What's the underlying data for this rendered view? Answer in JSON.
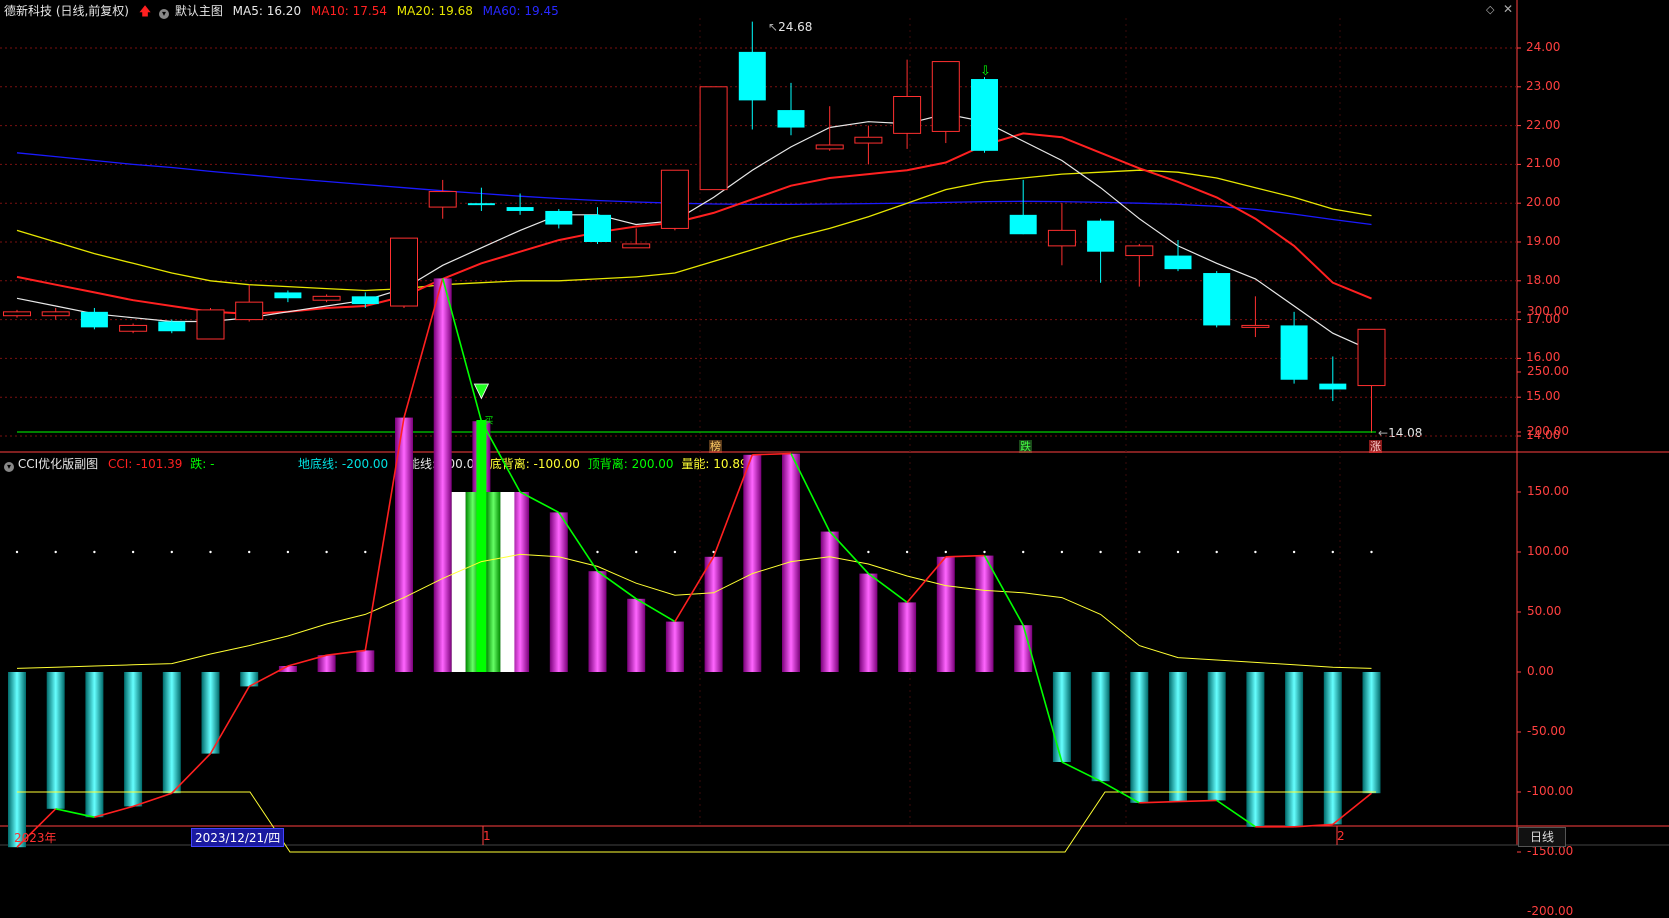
{
  "colors": {
    "bg": "#000000",
    "up": "#ff3030",
    "down": "#00ffff",
    "ma5": "#e8e8e8",
    "ma10": "#ff2020",
    "ma20": "#e6e600",
    "ma60": "#1a1aff",
    "axis": "#ff4040",
    "grid": "#7a1010",
    "bar_pos": "#cc00cc",
    "bar_neg": "#00c8c8",
    "green": "#00ff00",
    "yellow": "#ffff33",
    "cyan": "#00ffff"
  },
  "main": {
    "title": "德新科技 (日线,前复权)",
    "arrow_icon": "red-up-arrow-icon",
    "collapse_icon": "collapse-icon",
    "template_name": "默认主图",
    "ma5": "MA5: 16.20",
    "ma10": "MA10: 17.54",
    "ma20": "MA20: 19.68",
    "ma60": "MA60: 19.45",
    "high_label": "24.68",
    "low_label": "14.08",
    "markers": [
      "榜",
      "跌",
      "涨"
    ],
    "y_ticks": [
      "24.00",
      "23.00",
      "22.00",
      "21.00",
      "20.00",
      "19.00",
      "18.00",
      "17.00",
      "16.00",
      "15.00",
      "14.00"
    ]
  },
  "sub": {
    "title": "CCI优化版副图",
    "cci": "CCI: -101.39",
    "die": "跌: -",
    "dideng": "地底线: -200.00",
    "niuneng": "牛能线: 100.00",
    "dibeili": "底背离: -100.00",
    "dingbeili": "顶背离: 200.00",
    "liangneng": "量能: 10.89",
    "y_ticks": [
      "300.00",
      "250.00",
      "200.00",
      "150.00",
      "100.00",
      "50.00",
      "0.00",
      "-50.00",
      "-100.00",
      "-150.00",
      "-200.00"
    ],
    "signal_label": "买"
  },
  "bottom": {
    "year_label": "2023年",
    "cursor_date": "2023/12/21/四",
    "month1": "1",
    "month2": "2",
    "period_button": "日线"
  },
  "chart_data": [
    {
      "type": "candlestick",
      "title": "德新科技 (日线,前复权)",
      "ylim": [
        14.0,
        24.0
      ],
      "candles": [
        {
          "open": 17.1,
          "close": 17.2,
          "high": 17.25,
          "low": 17.05
        },
        {
          "open": 17.1,
          "close": 17.2,
          "high": 17.3,
          "low": 17.0
        },
        {
          "open": 17.2,
          "close": 16.8,
          "high": 17.3,
          "low": 16.75
        },
        {
          "open": 16.7,
          "close": 16.85,
          "high": 16.9,
          "low": 16.65
        },
        {
          "open": 16.95,
          "close": 16.7,
          "high": 17.0,
          "low": 16.65
        },
        {
          "open": 16.5,
          "close": 17.25,
          "high": 17.3,
          "low": 16.5
        },
        {
          "open": 17.0,
          "close": 17.45,
          "high": 17.9,
          "low": 16.95
        },
        {
          "open": 17.7,
          "close": 17.55,
          "high": 17.75,
          "low": 17.45
        },
        {
          "open": 17.5,
          "close": 17.6,
          "high": 17.65,
          "low": 17.45
        },
        {
          "open": 17.6,
          "close": 17.4,
          "high": 17.7,
          "low": 17.3
        },
        {
          "open": 17.35,
          "close": 19.1,
          "high": 19.1,
          "low": 17.3
        },
        {
          "open": 19.9,
          "close": 20.3,
          "high": 20.6,
          "low": 19.6
        },
        {
          "open": 20.0,
          "close": 19.95,
          "high": 20.4,
          "low": 19.8
        },
        {
          "open": 19.9,
          "close": 19.8,
          "high": 20.25,
          "low": 19.7
        },
        {
          "open": 19.8,
          "close": 19.45,
          "high": 19.85,
          "low": 19.35
        },
        {
          "open": 19.7,
          "close": 19.0,
          "high": 19.9,
          "low": 18.95
        },
        {
          "open": 18.85,
          "close": 18.95,
          "high": 19.35,
          "low": 18.85
        },
        {
          "open": 19.35,
          "close": 20.85,
          "high": 20.85,
          "low": 19.3
        },
        {
          "open": 20.35,
          "close": 23.0,
          "high": 23.0,
          "low": 21.2
        },
        {
          "open": 23.9,
          "close": 22.65,
          "high": 24.68,
          "low": 21.9
        },
        {
          "open": 22.4,
          "close": 21.95,
          "high": 23.1,
          "low": 21.75
        },
        {
          "open": 21.4,
          "close": 21.5,
          "high": 22.5,
          "low": 21.35
        },
        {
          "open": 21.55,
          "close": 21.7,
          "high": 22.0,
          "low": 21.0
        },
        {
          "open": 21.8,
          "close": 22.75,
          "high": 23.7,
          "low": 21.4
        },
        {
          "open": 21.85,
          "close": 23.65,
          "high": 23.65,
          "low": 21.55
        },
        {
          "open": 23.2,
          "close": 21.35,
          "high": 23.25,
          "low": 21.3
        },
        {
          "open": 19.7,
          "close": 19.2,
          "high": 20.6,
          "low": 19.2
        },
        {
          "open": 18.9,
          "close": 19.3,
          "high": 20.0,
          "low": 18.4
        },
        {
          "open": 19.55,
          "close": 18.75,
          "high": 19.6,
          "low": 17.95
        },
        {
          "open": 18.65,
          "close": 18.9,
          "high": 18.95,
          "low": 17.85
        },
        {
          "open": 18.65,
          "close": 18.3,
          "high": 19.05,
          "low": 18.25
        },
        {
          "open": 18.2,
          "close": 16.85,
          "high": 18.25,
          "low": 16.8
        },
        {
          "open": 16.8,
          "close": 16.85,
          "high": 17.6,
          "low": 16.55
        },
        {
          "open": 16.85,
          "close": 15.45,
          "high": 17.2,
          "low": 15.35
        },
        {
          "open": 15.35,
          "close": 15.2,
          "high": 16.05,
          "low": 14.9
        },
        {
          "open": 15.3,
          "close": 16.75,
          "high": 16.75,
          "low": 14.08
        }
      ],
      "ma5": [
        17.55,
        17.35,
        17.15,
        17.05,
        16.95,
        16.95,
        17.05,
        17.2,
        17.35,
        17.5,
        17.8,
        18.4,
        18.85,
        19.3,
        19.7,
        19.7,
        19.45,
        19.55,
        20.15,
        20.85,
        21.45,
        21.95,
        22.1,
        22.05,
        22.3,
        22.1,
        21.6,
        21.1,
        20.4,
        19.6,
        18.9,
        18.45,
        18.05,
        17.35,
        16.65,
        16.2
      ],
      "ma10": [
        18.1,
        17.9,
        17.7,
        17.5,
        17.35,
        17.2,
        17.15,
        17.2,
        17.3,
        17.35,
        17.6,
        18.05,
        18.45,
        18.75,
        19.05,
        19.25,
        19.4,
        19.5,
        19.75,
        20.1,
        20.45,
        20.65,
        20.75,
        20.85,
        21.05,
        21.5,
        21.8,
        21.7,
        21.3,
        20.9,
        20.55,
        20.15,
        19.6,
        18.9,
        17.95,
        17.54
      ],
      "ma20": [
        19.3,
        19.0,
        18.7,
        18.45,
        18.2,
        18.0,
        17.9,
        17.85,
        17.8,
        17.75,
        17.8,
        17.9,
        17.95,
        18.0,
        18.0,
        18.05,
        18.1,
        18.2,
        18.5,
        18.8,
        19.1,
        19.35,
        19.65,
        20.0,
        20.35,
        20.55,
        20.65,
        20.75,
        20.8,
        20.85,
        20.8,
        20.65,
        20.4,
        20.15,
        19.85,
        19.68
      ],
      "ma60": [
        21.3,
        21.2,
        21.1,
        21.0,
        20.92,
        20.82,
        20.73,
        20.64,
        20.56,
        20.48,
        20.4,
        20.32,
        20.25,
        20.18,
        20.12,
        20.07,
        20.03,
        20.0,
        19.98,
        19.97,
        19.97,
        19.98,
        19.99,
        20.0,
        20.02,
        20.04,
        20.05,
        20.04,
        20.02,
        20.0,
        19.97,
        19.92,
        19.84,
        19.72,
        19.58,
        19.45
      ]
    },
    {
      "type": "bar",
      "title": "CCI优化版副图",
      "ylim": [
        -200,
        330
      ],
      "cci": [
        -146,
        -114,
        -121,
        -112,
        -101,
        -68,
        -12,
        5,
        14,
        18,
        212,
        328,
        209,
        150,
        133,
        84,
        61,
        42,
        96,
        181,
        182,
        117,
        82,
        58,
        96,
        97,
        39,
        -75,
        -91,
        -109,
        -108,
        -107,
        -129,
        -129,
        -127,
        -101
      ],
      "yellow_line": [
        3,
        4,
        5,
        6,
        7,
        15,
        22,
        30,
        40,
        48,
        62,
        78,
        92,
        98,
        96,
        88,
        74,
        64,
        66,
        82,
        92,
        96,
        90,
        80,
        72,
        68,
        66,
        62,
        48,
        22,
        12,
        10,
        8,
        6,
        4,
        3
      ]
    }
  ]
}
